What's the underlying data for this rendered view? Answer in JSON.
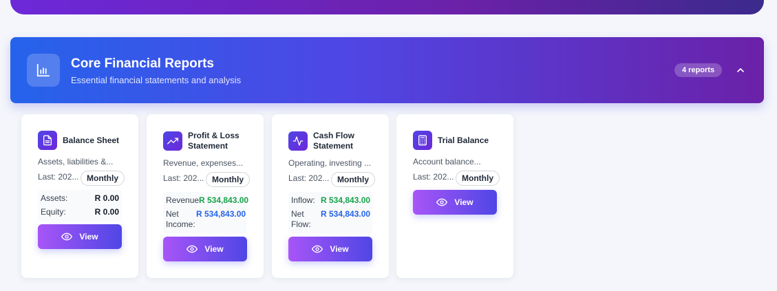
{
  "section": {
    "title": "Core Financial Reports",
    "subtitle": "Essential financial statements and analysis",
    "count_badge": "4 reports",
    "icon": "bar-chart-icon",
    "collapse_icon": "chevron-up-icon"
  },
  "colors": {
    "header_gradient_start": "#2563eb",
    "header_gradient_end": "#6b21a8",
    "button_gradient_start": "#a855f7",
    "button_gradient_end": "#4f46e5",
    "positive_value": "#16a34a",
    "info_value": "#2563eb"
  },
  "cards": [
    {
      "title": "Balance Sheet",
      "icon": "document-icon",
      "description": "Assets, liabilities &...",
      "last": "Last: 202...",
      "frequency": "Monthly",
      "metrics": [
        {
          "label": "Assets:",
          "value": "R 0.00"
        },
        {
          "label": "Equity:",
          "value": "R 0.00"
        }
      ],
      "view_label": "View"
    },
    {
      "title": "Profit & Loss Statement",
      "icon": "trending-up-icon",
      "description": "Revenue, expenses...",
      "last": "Last: 202...",
      "frequency": "Monthly",
      "metrics": [
        {
          "label": "Revenue:",
          "value": "R 534,843.00"
        },
        {
          "label": "Net Income:",
          "value": "R 534,843.00"
        }
      ],
      "view_label": "View"
    },
    {
      "title": "Cash Flow Statement",
      "icon": "activity-icon",
      "description": "Operating, investing ...",
      "last": "Last: 202...",
      "frequency": "Monthly",
      "metrics": [
        {
          "label": "Inflow:",
          "value": "R 534,843.00"
        },
        {
          "label": "Net Flow:",
          "value": "R 534,843.00"
        }
      ],
      "view_label": "View"
    },
    {
      "title": "Trial Balance",
      "icon": "calculator-icon",
      "description": "Account balance...",
      "last": "Last: 202...",
      "frequency": "Monthly",
      "view_label": "View"
    }
  ]
}
